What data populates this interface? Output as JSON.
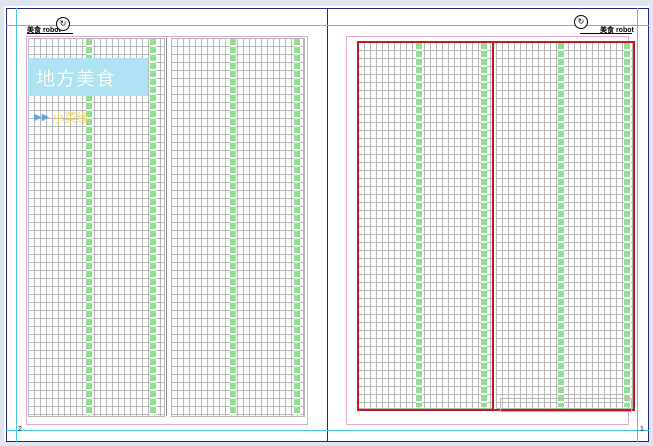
{
  "header": {
    "brand_left": "美食 robot",
    "brand_right": "美食 robot"
  },
  "left_page": {
    "title": "地方美食",
    "subtitle_arrows": "▶▶",
    "subtitle": "小菜缘",
    "page_number": "2"
  },
  "right_page": {
    "page_number": "1"
  },
  "colors": {
    "guide": "#46c6e8",
    "margin_guide": "#e3a7d3",
    "grid_line": "#b7b7b7",
    "green_column": "#8fe08f",
    "selection": "#c3181e",
    "banner": "#aee3f3",
    "subtitle": "#f2d05c"
  },
  "icons": {
    "logo": "circular-logo-icon",
    "arrows": "double-arrow-icon"
  }
}
